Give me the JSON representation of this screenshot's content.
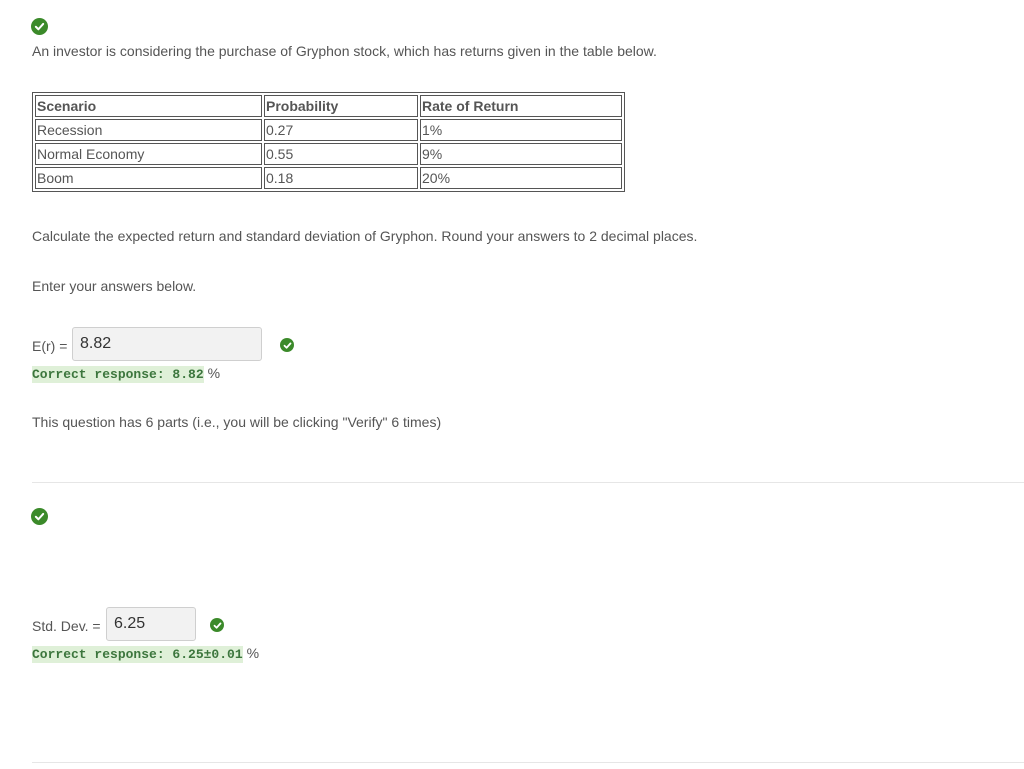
{
  "part1": {
    "intro": "An investor is considering the purchase of Gryphon stock, which has returns given in the table below.",
    "table": {
      "headers": [
        "Scenario",
        "Probability",
        "Rate of Return"
      ],
      "rows": [
        [
          "Recession",
          "0.27",
          "1%"
        ],
        [
          "Normal Economy",
          "0.55",
          "9%"
        ],
        [
          "Boom",
          "0.18",
          "20%"
        ]
      ]
    },
    "instruction": "Calculate the expected return and standard deviation of Gryphon. Round your answers to 2 decimal places.",
    "enter_prompt": "Enter your answers below.",
    "er_label": "E(r) =",
    "er_value": "8.82",
    "er_correct": "Correct response: 8.82",
    "er_unit": "%",
    "parts_note": "This question has 6 parts (i.e., you will be clicking \"Verify\" 6 times)"
  },
  "part2": {
    "sd_label": "Std. Dev. =",
    "sd_value": "6.25",
    "sd_correct": "Correct response: 6.25±0.01",
    "sd_unit": "%"
  },
  "icons": {
    "status": "check-circle-icon"
  },
  "colors": {
    "check_green": "#3b8a2a",
    "correct_bg": "#dff0d8",
    "correct_text": "#3c763d"
  }
}
